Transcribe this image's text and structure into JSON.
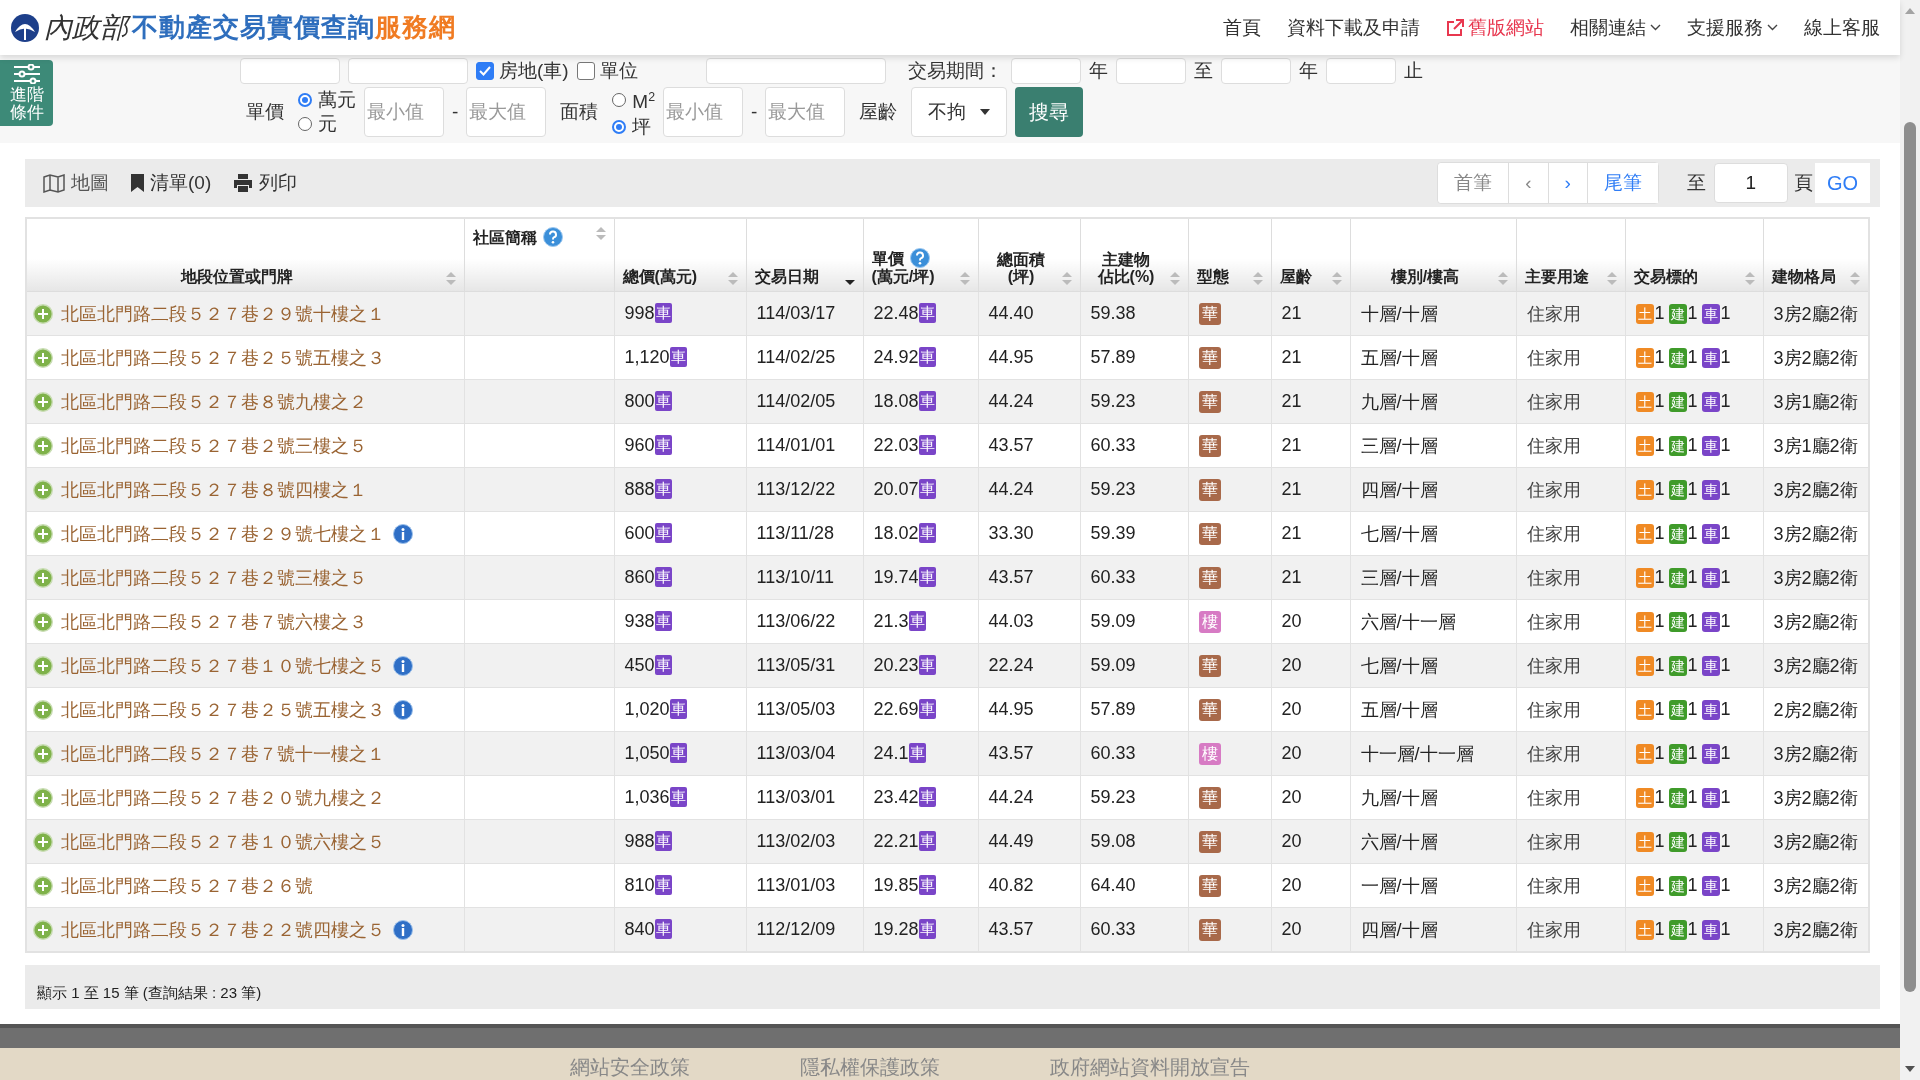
{
  "header": {
    "ministry": "內政部",
    "title": "不動產交易實價查詢",
    "title_suffix": "服務網",
    "nav": [
      {
        "label": "首頁",
        "kind": "plain"
      },
      {
        "label": "資料下載及申請",
        "kind": "plain"
      },
      {
        "label": "舊版網站",
        "kind": "external"
      },
      {
        "label": "相關連結",
        "kind": "dropdown"
      },
      {
        "label": "支援服務",
        "kind": "dropdown"
      },
      {
        "label": "線上客服",
        "kind": "plain"
      }
    ]
  },
  "search_form": {
    "advanced_button": "進階條件",
    "top_row": {
      "checkboxes": [
        {
          "label": "房地(車)",
          "checked": true
        },
        {
          "label": "單位",
          "checked": false
        }
      ],
      "period_label": "交易期間：",
      "period_units": [
        "年",
        "至",
        "年",
        "止"
      ]
    },
    "price": {
      "label": "單價",
      "units": [
        {
          "label": "萬元",
          "selected": true
        },
        {
          "label": "元",
          "selected": false
        }
      ],
      "min_placeholder": "最小值",
      "dash": "-",
      "max_placeholder": "最大值"
    },
    "area": {
      "label": "面積",
      "units": [
        {
          "label": "M$^{2}$",
          "selected": false
        },
        {
          "label": "坪",
          "selected": true
        }
      ],
      "min_placeholder": "最小值",
      "dash": "-",
      "max_placeholder": "最大值"
    },
    "age": {
      "label": "屋齡",
      "value": "不拘"
    },
    "search_button": "搜尋"
  },
  "toolbar": {
    "actions": [
      {
        "label": "地圖"
      },
      {
        "label": "清單(0)"
      },
      {
        "label": "列印"
      }
    ]
  },
  "pager": {
    "buttons": [
      {
        "label": "首筆",
        "disabled": true
      },
      {
        "label": "‹",
        "disabled": true
      },
      {
        "label": "›",
        "disabled": false
      },
      {
        "label": "尾筆",
        "disabled": false
      }
    ],
    "goto_label": "至",
    "page": "1",
    "page_suffix": "頁",
    "go": "GO"
  },
  "table": {
    "columns": [
      {
        "label": "地段位置或門牌",
        "help": false,
        "sorted": false
      },
      {
        "label": "社區簡稱",
        "help": true,
        "sorted": false
      },
      {
        "label": "總價(萬元)",
        "help": false,
        "sorted": false
      },
      {
        "label": "交易日期",
        "help": false,
        "sorted": true
      },
      {
        "label": "單價",
        "sub": "(萬元/坪)",
        "help": true,
        "sorted": false
      },
      {
        "label": "總面積",
        "sub": "(坪)",
        "help": false,
        "sorted": false
      },
      {
        "label": "主建物",
        "sub": "佔比(%)",
        "help": false,
        "sorted": false
      },
      {
        "label": "型態",
        "help": false,
        "sorted": false
      },
      {
        "label": "屋齡",
        "help": false,
        "sorted": false
      },
      {
        "label": "樓別/樓高",
        "help": false,
        "sorted": false
      },
      {
        "label": "主要用途",
        "help": false,
        "sorted": false
      },
      {
        "label": "交易標的",
        "help": false,
        "sorted": false
      },
      {
        "label": "建物格局",
        "help": false,
        "sorted": false
      }
    ],
    "rows": [
      {
        "address": "北區北門路二段５２７巷２９號十樓之１",
        "info": false,
        "total": "998",
        "total_badge": "車",
        "date": "114/03/17",
        "unit_price": "22.48",
        "price_badge": "車",
        "area": "44.40",
        "ratio": "59.38",
        "type": {
          "label": "華",
          "color": "#a8694a"
        },
        "age": "21",
        "floor": "十層/十層",
        "use": "住家用",
        "targets": [
          {
            "label": "土",
            "count": "1",
            "color": "#f08a24"
          },
          {
            "label": "建",
            "count": "1",
            "color": "#3f9b2a"
          },
          {
            "label": "車",
            "count": "1",
            "color": "#7a45c8"
          }
        ],
        "layout": "3房2廳2衛"
      },
      {
        "address": "北區北門路二段５２７巷２５號五樓之３",
        "info": false,
        "total": "1,120",
        "total_badge": "車",
        "date": "114/02/25",
        "unit_price": "24.92",
        "price_badge": "車",
        "area": "44.95",
        "ratio": "57.89",
        "type": {
          "label": "華",
          "color": "#a8694a"
        },
        "age": "21",
        "floor": "五層/十層",
        "use": "住家用",
        "targets": [
          {
            "label": "土",
            "count": "1",
            "color": "#f08a24"
          },
          {
            "label": "建",
            "count": "1",
            "color": "#3f9b2a"
          },
          {
            "label": "車",
            "count": "1",
            "color": "#7a45c8"
          }
        ],
        "layout": "3房2廳2衛"
      },
      {
        "address": "北區北門路二段５２７巷８號九樓之２",
        "info": false,
        "total": "800",
        "total_badge": "車",
        "date": "114/02/05",
        "unit_price": "18.08",
        "price_badge": "車",
        "area": "44.24",
        "ratio": "59.23",
        "type": {
          "label": "華",
          "color": "#a8694a"
        },
        "age": "21",
        "floor": "九層/十層",
        "use": "住家用",
        "targets": [
          {
            "label": "土",
            "count": "1",
            "color": "#f08a24"
          },
          {
            "label": "建",
            "count": "1",
            "color": "#3f9b2a"
          },
          {
            "label": "車",
            "count": "1",
            "color": "#7a45c8"
          }
        ],
        "layout": "3房1廳2衛"
      },
      {
        "address": "北區北門路二段５２７巷２號三樓之５",
        "info": false,
        "total": "960",
        "total_badge": "車",
        "date": "114/01/01",
        "unit_price": "22.03",
        "price_badge": "車",
        "area": "43.57",
        "ratio": "60.33",
        "type": {
          "label": "華",
          "color": "#a8694a"
        },
        "age": "21",
        "floor": "三層/十層",
        "use": "住家用",
        "targets": [
          {
            "label": "土",
            "count": "1",
            "color": "#f08a24"
          },
          {
            "label": "建",
            "count": "1",
            "color": "#3f9b2a"
          },
          {
            "label": "車",
            "count": "1",
            "color": "#7a45c8"
          }
        ],
        "layout": "3房1廳2衛"
      },
      {
        "address": "北區北門路二段５２７巷８號四樓之１",
        "info": false,
        "total": "888",
        "total_badge": "車",
        "date": "113/12/22",
        "unit_price": "20.07",
        "price_badge": "車",
        "area": "44.24",
        "ratio": "59.23",
        "type": {
          "label": "華",
          "color": "#a8694a"
        },
        "age": "21",
        "floor": "四層/十層",
        "use": "住家用",
        "targets": [
          {
            "label": "土",
            "count": "1",
            "color": "#f08a24"
          },
          {
            "label": "建",
            "count": "1",
            "color": "#3f9b2a"
          },
          {
            "label": "車",
            "count": "1",
            "color": "#7a45c8"
          }
        ],
        "layout": "3房2廳2衛"
      },
      {
        "address": "北區北門路二段５２７巷２９號七樓之１",
        "info": true,
        "total": "600",
        "total_badge": "車",
        "date": "113/11/28",
        "unit_price": "18.02",
        "price_badge": "車",
        "area": "33.30",
        "ratio": "59.39",
        "type": {
          "label": "華",
          "color": "#a8694a"
        },
        "age": "21",
        "floor": "七層/十層",
        "use": "住家用",
        "targets": [
          {
            "label": "土",
            "count": "1",
            "color": "#f08a24"
          },
          {
            "label": "建",
            "count": "1",
            "color": "#3f9b2a"
          },
          {
            "label": "車",
            "count": "1",
            "color": "#7a45c8"
          }
        ],
        "layout": "3房2廳2衛"
      },
      {
        "address": "北區北門路二段５２７巷２號三樓之５",
        "info": false,
        "total": "860",
        "total_badge": "車",
        "date": "113/10/11",
        "unit_price": "19.74",
        "price_badge": "車",
        "area": "43.57",
        "ratio": "60.33",
        "type": {
          "label": "華",
          "color": "#a8694a"
        },
        "age": "21",
        "floor": "三層/十層",
        "use": "住家用",
        "targets": [
          {
            "label": "土",
            "count": "1",
            "color": "#f08a24"
          },
          {
            "label": "建",
            "count": "1",
            "color": "#3f9b2a"
          },
          {
            "label": "車",
            "count": "1",
            "color": "#7a45c8"
          }
        ],
        "layout": "3房2廳2衛"
      },
      {
        "address": "北區北門路二段５２７巷７號六樓之３",
        "info": false,
        "total": "938",
        "total_badge": "車",
        "date": "113/06/22",
        "unit_price": "21.3",
        "price_badge": "車",
        "area": "44.03",
        "ratio": "59.09",
        "type": {
          "label": "樓",
          "color": "#d77bc4"
        },
        "age": "20",
        "floor": "六層/十一層",
        "use": "住家用",
        "targets": [
          {
            "label": "土",
            "count": "1",
            "color": "#f08a24"
          },
          {
            "label": "建",
            "count": "1",
            "color": "#3f9b2a"
          },
          {
            "label": "車",
            "count": "1",
            "color": "#7a45c8"
          }
        ],
        "layout": "3房2廳2衛"
      },
      {
        "address": "北區北門路二段５２７巷１０號七樓之５",
        "info": true,
        "total": "450",
        "total_badge": "車",
        "date": "113/05/31",
        "unit_price": "20.23",
        "price_badge": "車",
        "area": "22.24",
        "ratio": "59.09",
        "type": {
          "label": "華",
          "color": "#a8694a"
        },
        "age": "20",
        "floor": "七層/十層",
        "use": "住家用",
        "targets": [
          {
            "label": "土",
            "count": "1",
            "color": "#f08a24"
          },
          {
            "label": "建",
            "count": "1",
            "color": "#3f9b2a"
          },
          {
            "label": "車",
            "count": "1",
            "color": "#7a45c8"
          }
        ],
        "layout": "3房2廳2衛"
      },
      {
        "address": "北區北門路二段５２７巷２５號五樓之３",
        "info": true,
        "total": "1,020",
        "total_badge": "車",
        "date": "113/05/03",
        "unit_price": "22.69",
        "price_badge": "車",
        "area": "44.95",
        "ratio": "57.89",
        "type": {
          "label": "華",
          "color": "#a8694a"
        },
        "age": "20",
        "floor": "五層/十層",
        "use": "住家用",
        "targets": [
          {
            "label": "土",
            "count": "1",
            "color": "#f08a24"
          },
          {
            "label": "建",
            "count": "1",
            "color": "#3f9b2a"
          },
          {
            "label": "車",
            "count": "1",
            "color": "#7a45c8"
          }
        ],
        "layout": "2房2廳2衛"
      },
      {
        "address": "北區北門路二段５２７巷７號十一樓之１",
        "info": false,
        "total": "1,050",
        "total_badge": "車",
        "date": "113/03/04",
        "unit_price": "24.1",
        "price_badge": "車",
        "area": "43.57",
        "ratio": "60.33",
        "type": {
          "label": "樓",
          "color": "#d77bc4"
        },
        "age": "20",
        "floor": "十一層/十一層",
        "use": "住家用",
        "targets": [
          {
            "label": "土",
            "count": "1",
            "color": "#f08a24"
          },
          {
            "label": "建",
            "count": "1",
            "color": "#3f9b2a"
          },
          {
            "label": "車",
            "count": "1",
            "color": "#7a45c8"
          }
        ],
        "layout": "3房2廳2衛"
      },
      {
        "address": "北區北門路二段５２７巷２０號九樓之２",
        "info": false,
        "total": "1,036",
        "total_badge": "車",
        "date": "113/03/01",
        "unit_price": "23.42",
        "price_badge": "車",
        "area": "44.24",
        "ratio": "59.23",
        "type": {
          "label": "華",
          "color": "#a8694a"
        },
        "age": "20",
        "floor": "九層/十層",
        "use": "住家用",
        "targets": [
          {
            "label": "土",
            "count": "1",
            "color": "#f08a24"
          },
          {
            "label": "建",
            "count": "1",
            "color": "#3f9b2a"
          },
          {
            "label": "車",
            "count": "1",
            "color": "#7a45c8"
          }
        ],
        "layout": "3房2廳2衛"
      },
      {
        "address": "北區北門路二段５２７巷１０號六樓之５",
        "info": false,
        "total": "988",
        "total_badge": "車",
        "date": "113/02/03",
        "unit_price": "22.21",
        "price_badge": "車",
        "area": "44.49",
        "ratio": "59.08",
        "type": {
          "label": "華",
          "color": "#a8694a"
        },
        "age": "20",
        "floor": "六層/十層",
        "use": "住家用",
        "targets": [
          {
            "label": "土",
            "count": "1",
            "color": "#f08a24"
          },
          {
            "label": "建",
            "count": "1",
            "color": "#3f9b2a"
          },
          {
            "label": "車",
            "count": "1",
            "color": "#7a45c8"
          }
        ],
        "layout": "3房2廳2衛"
      },
      {
        "address": "北區北門路二段５２７巷２６號",
        "info": false,
        "total": "810",
        "total_badge": "車",
        "date": "113/01/03",
        "unit_price": "19.85",
        "price_badge": "車",
        "area": "40.82",
        "ratio": "64.40",
        "type": {
          "label": "華",
          "color": "#a8694a"
        },
        "age": "20",
        "floor": "一層/十層",
        "use": "住家用",
        "targets": [
          {
            "label": "土",
            "count": "1",
            "color": "#f08a24"
          },
          {
            "label": "建",
            "count": "1",
            "color": "#3f9b2a"
          },
          {
            "label": "車",
            "count": "1",
            "color": "#7a45c8"
          }
        ],
        "layout": "3房2廳2衛"
      },
      {
        "address": "北區北門路二段５２７巷２２號四樓之５",
        "info": true,
        "total": "840",
        "total_badge": "車",
        "date": "112/12/09",
        "unit_price": "19.28",
        "price_badge": "車",
        "area": "43.57",
        "ratio": "60.33",
        "type": {
          "label": "華",
          "color": "#a8694a"
        },
        "age": "20",
        "floor": "四層/十層",
        "use": "住家用",
        "targets": [
          {
            "label": "土",
            "count": "1",
            "color": "#f08a24"
          },
          {
            "label": "建",
            "count": "1",
            "color": "#3f9b2a"
          },
          {
            "label": "車",
            "count": "1",
            "color": "#7a45c8"
          }
        ],
        "layout": "3房2廳2衛"
      }
    ]
  },
  "status": "顯示 1 至 15 筆 (查詢結果 : 23 筆)",
  "footer": {
    "links": [
      "網站安全政策",
      "隱私權保護政策",
      "政府網站資料開放宣告"
    ]
  }
}
